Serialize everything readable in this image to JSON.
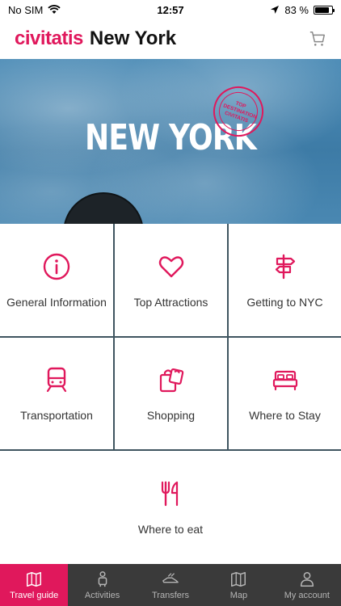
{
  "status_bar": {
    "carrier": "No SIM",
    "time": "12:57",
    "battery_text": "83 %",
    "battery_level": 0.83
  },
  "header": {
    "brand": "civitatis",
    "city": "New York",
    "cart_icon": "cart-icon"
  },
  "hero": {
    "title": "NEW YORK",
    "stamp_text": "TOP DESTINATION CIVITATIS"
  },
  "tiles": [
    {
      "label": "General Information",
      "icon": "info-icon"
    },
    {
      "label": "Top Attractions",
      "icon": "heart-icon"
    },
    {
      "label": "Getting to NYC",
      "icon": "signpost-icon"
    },
    {
      "label": "Transportation",
      "icon": "train-icon"
    },
    {
      "label": "Shopping",
      "icon": "shopping-bags-icon"
    },
    {
      "label": "Where to Stay",
      "icon": "bed-icon"
    },
    {
      "label": "Where to eat",
      "icon": "fork-knife-icon"
    }
  ],
  "tabbar": [
    {
      "label": "Travel guide",
      "icon": "map-guide-icon",
      "active": true
    },
    {
      "label": "Activities",
      "icon": "activities-icon",
      "active": false
    },
    {
      "label": "Transfers",
      "icon": "transfers-icon",
      "active": false
    },
    {
      "label": "Map",
      "icon": "map-icon",
      "active": false
    },
    {
      "label": "My account",
      "icon": "user-icon",
      "active": false
    }
  ],
  "colors": {
    "brand": "#e0185c",
    "tabbar_bg": "#3a3a3a",
    "text": "#333333"
  }
}
